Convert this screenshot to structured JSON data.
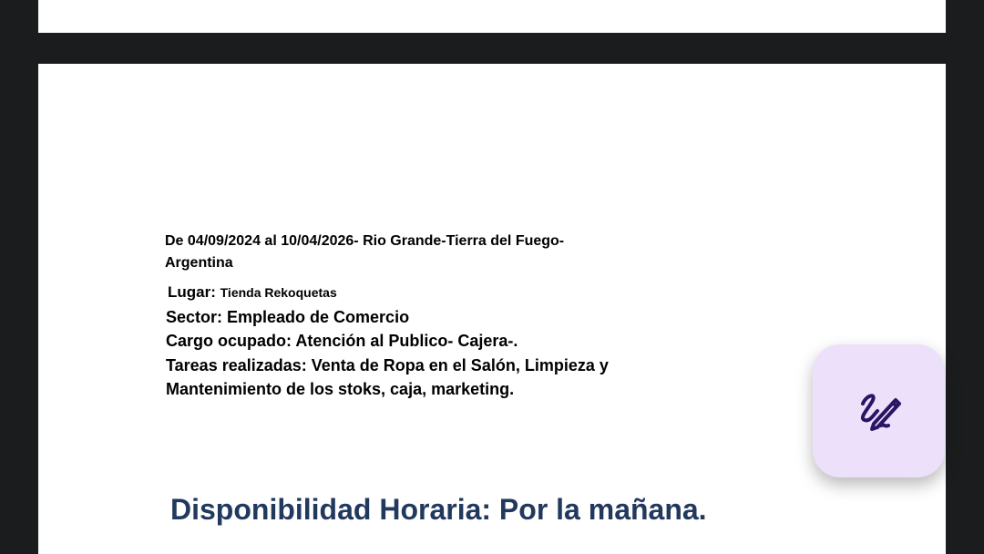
{
  "document": {
    "experience": {
      "dates_line": "De 04/09/2024  al  10/04/2026- Rio Grande-Tierra del Fuego-",
      "country_line": "Argentina",
      "place_label": "Lugar:",
      "place_value": "Tienda Rekoquetas",
      "sector_line": "Sector: Empleado de Comercio",
      "position_line": "Cargo ocupado: Atención al Publico- Cajera-.",
      "tasks_line_1": "Tareas realizadas: Venta de Ropa en el Salón, Limpieza y",
      "tasks_line_2": "Mantenimiento de los stoks, caja, marketing."
    },
    "availability_heading": "Disponibilidad Horaria: Por la mañana."
  },
  "fab": {
    "icon": "signature-pen-icon",
    "background_color": "#ece0fb",
    "icon_color": "#2a1463"
  },
  "colors": {
    "viewer_background": "#1b1c1e",
    "page_background": "#ffffff",
    "heading_color": "#22395e"
  }
}
